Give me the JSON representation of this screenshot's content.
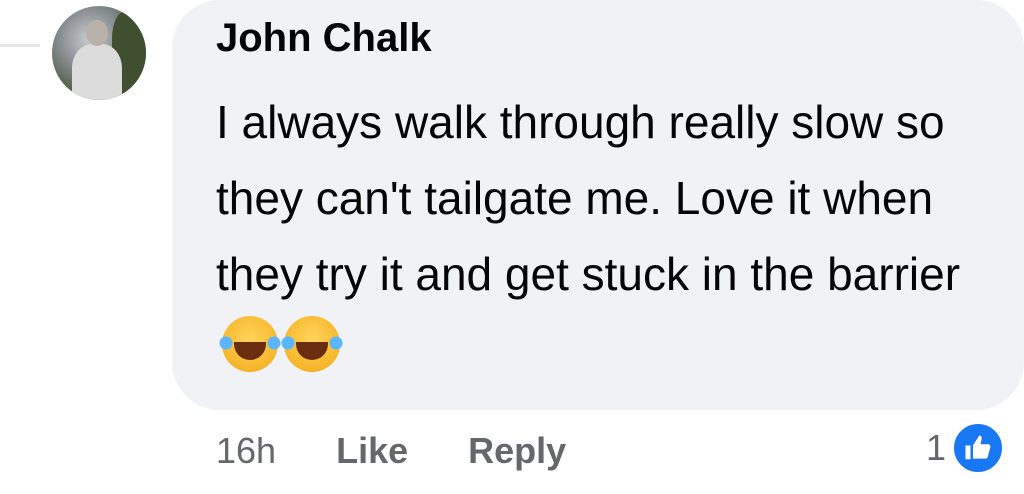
{
  "comment": {
    "author": "John Chalk",
    "text": "I always walk through really slow so they can't tailgate me. Love it when they try it and get stuck in the barrier",
    "emojis": [
      "laughing-tears-emoji",
      "laughing-tears-emoji"
    ]
  },
  "meta": {
    "time": "16h",
    "like_label": "Like",
    "reply_label": "Reply"
  },
  "reactions": {
    "count": "1",
    "icon": "thumbs-up-icon",
    "color": "#1877f2"
  }
}
